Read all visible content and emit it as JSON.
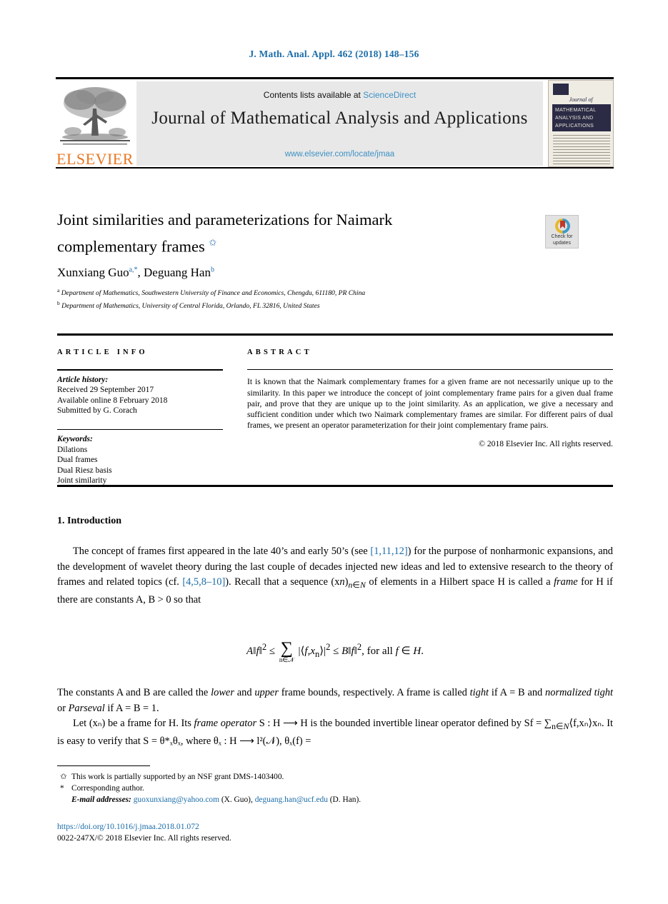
{
  "running_head": "J. Math. Anal. Appl. 462 (2018) 148–156",
  "masthead": {
    "contents_prefix": "Contents lists available at ",
    "sciencedirect": "ScienceDirect",
    "journal_title": "Journal of Mathematical Analysis and Applications",
    "journal_url": "www.elsevier.com/locate/jmaa",
    "publisher": "ELSEVIER",
    "cover": {
      "journal_of": "Journal of",
      "band_title": "MATHEMATICAL ANALYSIS AND APPLICATIONS"
    }
  },
  "article": {
    "title_line1": "Joint similarities and parameterizations for Naimark",
    "title_line2": "complementary frames",
    "title_footnote_mark": "✩",
    "authors": "Xunxiang Guo, Deguang Han",
    "author1_name": "Xunxiang Guo",
    "author1_marks": "a,*",
    "author2_name": "Deguang Han",
    "author2_marks": "b",
    "affiliation_a_mark": "a",
    "affiliation_a": "Department of Mathematics, Southwestern University of Finance and Economics, Chengdu, 611180, PR China",
    "affiliation_b_mark": "b",
    "affiliation_b": "Department of Mathematics, University of Central Florida, Orlando, FL 32816, United States"
  },
  "crossmark": {
    "line1": "Check for",
    "line2": "updates"
  },
  "info": {
    "heading": "ARTICLE INFO",
    "history_label": "Article history:",
    "history_lines": [
      "Received 29 September 2017",
      "Available online 8 February 2018",
      "Submitted by G. Corach"
    ],
    "keywords_label": "Keywords:",
    "keywords": [
      "Dilations",
      "Dual frames",
      "Dual Riesz basis",
      "Joint similarity"
    ]
  },
  "abstract": {
    "heading": "ABSTRACT",
    "text": "It is known that the Naimark complementary frames for a given frame are not necessarily unique up to the similarity. In this paper we introduce the concept of joint complementary frame pairs for a given dual frame pair, and prove that they are unique up to the joint similarity. As an application, we give a necessary and sufficient condition under which two Naimark complementary frames are similar. For different pairs of dual frames, we present an operator parameterization for their joint complementary frame pairs.",
    "copyright": "© 2018 Elsevier Inc. All rights reserved."
  },
  "body": {
    "section_number": "1.",
    "section_title": "Introduction",
    "para1_a": "The concept of frames first appeared in the late 40’s and early 50’s (see ",
    "para1_cite1": "[1,11,12]",
    "para1_b": ") for the purpose of nonharmonic expansions, and the development of wavelet theory during the last couple of decades injected new ideas and led to extensive research to the theory of frames and related topics (cf. ",
    "para1_cite2": "[4,5,8–10]",
    "para1_c": "). Recall that a sequence (x",
    "para1_d": " of elements in a Hilbert space H is called a ",
    "para1_frame_it": "frame",
    "para1_e": " for H if there are constants A, B > 0 so that",
    "equation": "A‖f‖² ≤ ∑ |⟨f,xₙ⟩|² ≤ B‖f‖², for all f ∈ H.",
    "equation_sum_sub": "n∈𝒩",
    "para2_a": "The constants A and B are called the ",
    "para2_lower": "lower",
    "para2_b": " and ",
    "para2_upper": "upper",
    "para2_c": " frame bounds, respectively. A frame is called ",
    "para2_tight": "tight",
    "para2_d": " if A = B and ",
    "para2_normtight": "normalized tight",
    "para2_e": " or ",
    "para2_parseval": "Parseval",
    "para2_f": " if A = B = 1.",
    "para3_a": "Let (xₙ) be a frame for H. Its ",
    "para3_frameop": "frame operator",
    "para3_b": " S : H ⟶ H is the bounded invertible linear operator defined by Sf = ∑",
    "para3_c": "⟨f,xₙ⟩xₙ. It is easy to verify that S = θ*ₓθₓ, where θₓ : H ⟶ l²(𝒩), θₓ(f) ="
  },
  "footnotes": {
    "star_mark": "✩",
    "star_text": "This work is partially supported by an NSF grant DMS-1403400.",
    "corr_mark": "*",
    "corr_text": "Corresponding author.",
    "email_label": "E-mail addresses:",
    "email1": "guoxunxiang@yahoo.com",
    "email1_who": "(X. Guo),",
    "email2": "deguang.han@ucf.edu",
    "email2_who": "(D. Han)."
  },
  "imprint": {
    "doi": "https://doi.org/10.1016/j.jmaa.2018.01.072",
    "issn_line": "0022-247X/© 2018 Elsevier Inc. All rights reserved."
  },
  "colors": {
    "link_blue": "#1b6ca8",
    "sciencedirect_blue": "#3d91c4",
    "elsevier_orange": "#E87722",
    "cover_navy": "#2b2b45"
  }
}
